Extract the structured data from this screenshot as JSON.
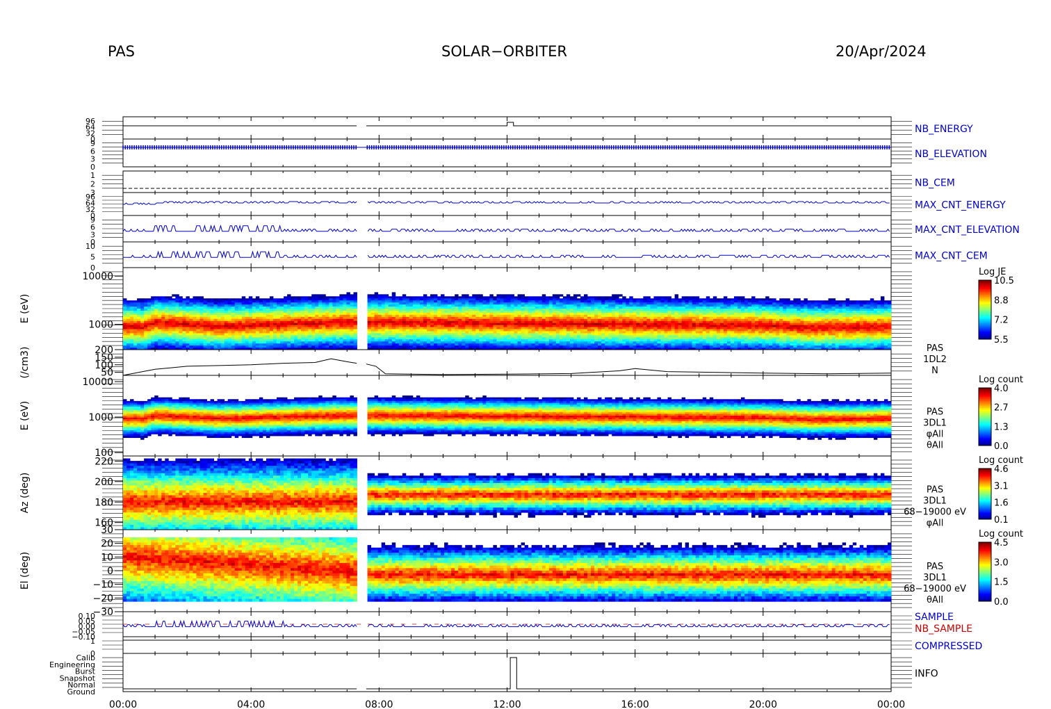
{
  "header": {
    "instrument": "PAS",
    "mission": "SOLAR−ORBITER",
    "date": "20/Apr/2024"
  },
  "chart_data": {
    "type": "heatmap",
    "x_tick_labels": [
      "00:00",
      "04:00",
      "08:00",
      "12:00",
      "16:00",
      "20:00",
      "00:00"
    ],
    "x_hours": [
      0,
      4,
      8,
      12,
      16,
      20,
      24
    ],
    "data_gaps_hours": [
      [
        7.3,
        7.6
      ]
    ],
    "panels": [
      {
        "key": "nb_energy",
        "label": "NB_ENERGY",
        "label_color": "#0000cc",
        "tick_labels": [
          "96",
          "64",
          "32",
          "0"
        ],
        "kind": "status"
      },
      {
        "key": "nb_elevation",
        "label": "NB_ELEVATION",
        "label_color": "#0000cc",
        "tick_labels": [
          "9",
          "6",
          "3",
          "0"
        ],
        "kind": "status"
      },
      {
        "key": "nb_cem",
        "label": "NB_CEM",
        "label_color": "#0000cc",
        "tick_labels": [
          "1",
          "2",
          "3"
        ],
        "kind": "status"
      },
      {
        "key": "max_cnt_energy",
        "label": "MAX_CNT_ENERGY",
        "label_color": "#0000cc",
        "tick_labels": [
          "96",
          "64",
          "32",
          "0"
        ],
        "kind": "status"
      },
      {
        "key": "max_cnt_elevation",
        "label": "MAX_CNT_ELEVATION",
        "label_color": "#0000cc",
        "tick_labels": [
          "9",
          "6",
          "3",
          "0"
        ],
        "kind": "status"
      },
      {
        "key": "max_cnt_cem",
        "label": "MAX_CNT_CEM",
        "label_color": "#0000cc",
        "tick_labels": [
          "10",
          "5",
          "0"
        ],
        "kind": "status"
      },
      {
        "key": "energy_je",
        "ylabel": "E (eV)",
        "yscale": "log",
        "ylim": [
          300,
          15000
        ],
        "y_tick_labels": [
          "10000",
          "1000"
        ],
        "y_tick_values": [
          10000,
          1000
        ],
        "colorbar": {
          "title": "Log JE",
          "ticks": [
            "10.5",
            "8.8",
            "7.2",
            "5.5"
          ],
          "range": [
            5.5,
            10.5
          ]
        },
        "peak_energy_ev": [
          {
            "h": 0.5,
            "v": 800
          },
          {
            "h": 1.0,
            "v": 1100
          },
          {
            "h": 3,
            "v": 900
          },
          {
            "h": 5,
            "v": 1000
          },
          {
            "h": 7,
            "v": 1100
          },
          {
            "h": 8,
            "v": 1100
          },
          {
            "h": 12,
            "v": 1050
          },
          {
            "h": 16,
            "v": 1000
          },
          {
            "h": 20,
            "v": 950
          },
          {
            "h": 21.5,
            "v": 850
          },
          {
            "h": 24,
            "v": 900
          }
        ]
      },
      {
        "key": "density",
        "ylabel": "(/cm3)",
        "ylim": [
          30,
          200
        ],
        "y_tick_labels": [
          "200",
          "150",
          "100",
          "50"
        ],
        "y_tick_values": [
          200,
          150,
          100,
          50
        ],
        "right_labels": [
          "PAS",
          "1DL2",
          "N"
        ],
        "series": [
          {
            "x": [
              0,
              1,
              1.5,
              2,
              3,
              4,
              5,
              6,
              6.5,
              7,
              7.3,
              7.6,
              7.9,
              8.2,
              10,
              12,
              14,
              15.5,
              16,
              17,
              20,
              22,
              24
            ],
            "y": [
              30,
              70,
              80,
              90,
              95,
              100,
              110,
              115,
              140,
              120,
              110,
              105,
              90,
              40,
              35,
              38,
              42,
              60,
              75,
              55,
              45,
              40,
              45
            ]
          }
        ]
      },
      {
        "key": "energy_count",
        "ylabel": "E (eV)",
        "yscale": "log",
        "ylim": [
          80,
          15000
        ],
        "y_tick_labels": [
          "10000",
          "1000",
          "100"
        ],
        "y_tick_values": [
          10000,
          1000,
          100
        ],
        "right_labels": [
          "PAS",
          "3DL1",
          "φAll",
          "θAll"
        ],
        "colorbar": {
          "title": "Log count",
          "ticks": [
            "4.0",
            "2.7",
            "1.3",
            "0.0"
          ],
          "range": [
            0,
            4
          ]
        }
      },
      {
        "key": "azimuth",
        "ylabel": "Az (deg)",
        "ylim": [
          153,
          225
        ],
        "y_tick_labels": [
          "220",
          "200",
          "180",
          "160"
        ],
        "y_tick_values": [
          220,
          200,
          180,
          160
        ],
        "right_labels": [
          "PAS",
          "3DL1",
          "68−19000 eV",
          "φAll"
        ],
        "colorbar": {
          "title": "Log count",
          "ticks": [
            "4.6",
            "3.1",
            "1.6",
            "0.1"
          ],
          "range": [
            0.1,
            4.6
          ]
        }
      },
      {
        "key": "elevation",
        "ylabel": "El (deg)",
        "ylim": [
          -30,
          30
        ],
        "y_tick_labels": [
          "30",
          "20",
          "10",
          "0",
          "−10",
          "−20",
          "−30"
        ],
        "y_tick_values": [
          30,
          20,
          10,
          0,
          -10,
          -20,
          -30
        ],
        "right_labels": [
          "PAS",
          "3DL1",
          "68−19000 eV",
          "θAll"
        ],
        "colorbar": {
          "title": "Log count",
          "ticks": [
            "4.5",
            "3.0",
            "1.5",
            "0.0"
          ],
          "range": [
            0,
            4.5
          ]
        }
      },
      {
        "key": "sample",
        "labels": [
          {
            "text": "SAMPLE",
            "color": "#0000cc"
          },
          {
            "text": "NB_SAMPLE",
            "color": "#cc0000"
          }
        ],
        "tick_labels": [
          "0.10",
          "0.05",
          "0.00",
          "−0.05",
          "−0.10"
        ],
        "kind": "status"
      },
      {
        "key": "compressed",
        "label": "COMPRESSED",
        "label_color": "#0000cc",
        "tick_labels": [
          "1",
          "0"
        ],
        "kind": "status"
      },
      {
        "key": "info",
        "label": "INFO",
        "label_color": "#000000",
        "tick_labels": [
          "Calib",
          "Engineering",
          "Burst",
          "Snapshot",
          "Normal",
          "Ground"
        ],
        "kind": "status"
      }
    ]
  }
}
